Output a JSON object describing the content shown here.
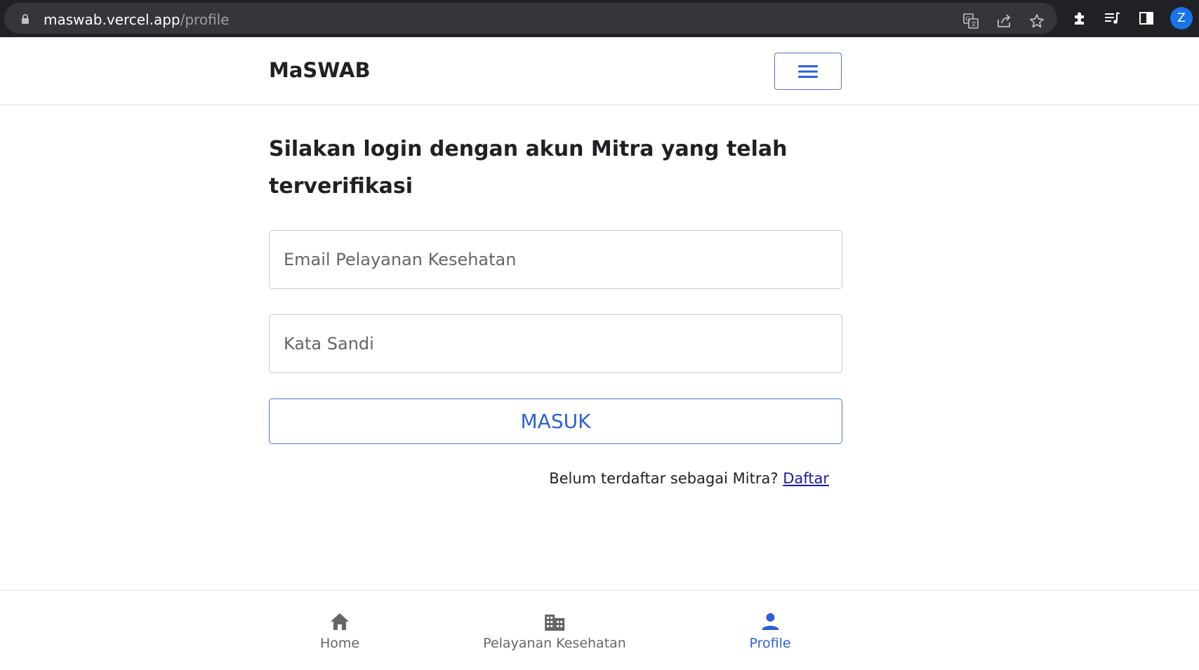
{
  "browser": {
    "url_host": "maswab.vercel.app",
    "url_path": "/profile",
    "avatar_letter": "Z",
    "toolbar_icons": [
      "translate-icon",
      "share-icon",
      "bookmark-star-icon",
      "extensions-icon",
      "media-queue-icon",
      "side-panel-icon"
    ]
  },
  "header": {
    "brand": "MaSWAB",
    "menu_icon": "hamburger-icon"
  },
  "login": {
    "heading": "Silakan login dengan akun Mitra yang telah terverifikasi",
    "email_placeholder": "Email Pelayanan Kesehatan",
    "password_placeholder": "Kata Sandi",
    "submit_label": "MASUK",
    "register_prompt": "Belum terdaftar sebagai Mitra?",
    "register_link": "Daftar"
  },
  "bottom_nav": {
    "items": [
      {
        "label": "Home",
        "icon": "home-icon",
        "active": false
      },
      {
        "label": "Pelayanan Kesehatan",
        "icon": "building-icon",
        "active": false
      },
      {
        "label": "Profile",
        "icon": "person-icon",
        "active": true
      }
    ]
  },
  "colors": {
    "accent": "#2f5fd8",
    "browser_bg": "#202124",
    "link": "#1a1aa6"
  }
}
